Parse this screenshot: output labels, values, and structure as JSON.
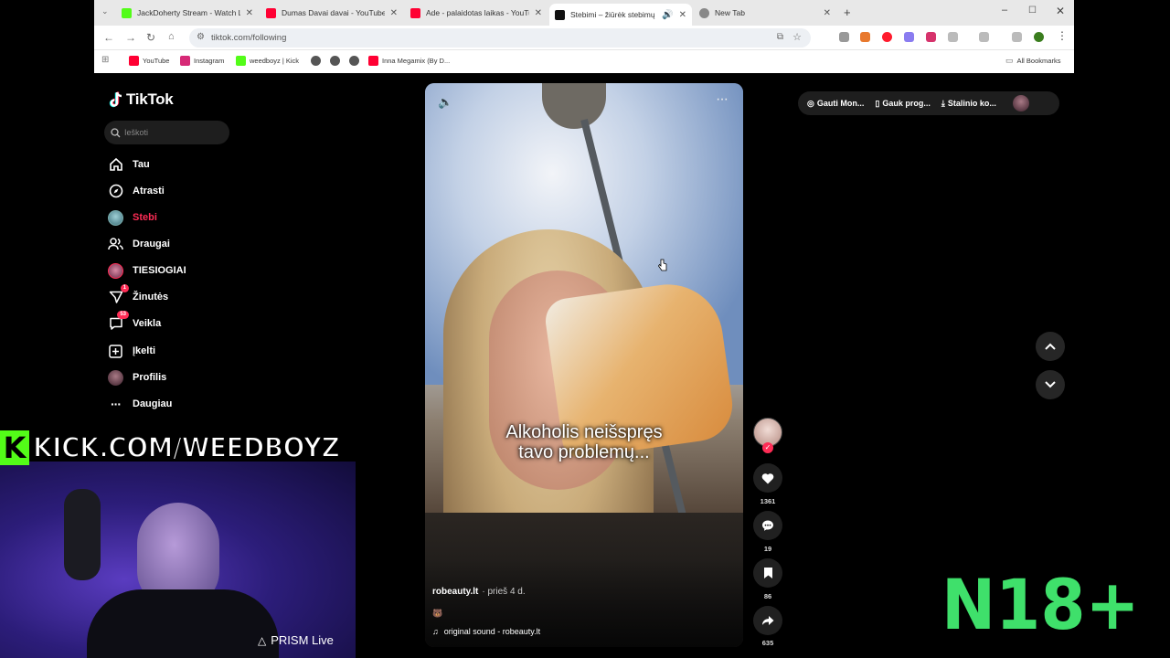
{
  "browser": {
    "tabs": [
      {
        "title": "JackDoherty Stream - Watch Liv",
        "fav_color": "#53fc18"
      },
      {
        "title": "Dumas Davai davai - YouTube",
        "fav_color": "#ff0033"
      },
      {
        "title": "Ade - palaidotas laikas - YouTu",
        "fav_color": "#ff0033"
      },
      {
        "title": "Stebimi – žiūrėk stebimų kū",
        "fav_color": "#111111"
      },
      {
        "title": "New Tab",
        "fav_color": "#888888"
      }
    ],
    "url": "tiktok.com/following",
    "bookmarks": [
      {
        "label": "YouTube",
        "fav_color": "#ff0033"
      },
      {
        "label": "Instagram",
        "fav_color": "#d62976"
      },
      {
        "label": "weedboyz | Kick",
        "fav_color": "#53fc18"
      },
      {
        "label": "",
        "fav_color": "#555555"
      },
      {
        "label": "",
        "fav_color": "#555555"
      },
      {
        "label": "",
        "fav_color": "#555555"
      },
      {
        "label": "Inna Megamix (By D...",
        "fav_color": "#ff0033"
      }
    ],
    "all_bookmarks": "All Bookmarks"
  },
  "tiktok": {
    "logo": "TikTok",
    "search_placeholder": "Ieškoti",
    "nav": [
      {
        "label": "Tau",
        "icon": "home-icon",
        "active": false
      },
      {
        "label": "Atrasti",
        "icon": "compass-icon",
        "active": false
      },
      {
        "label": "Stebi",
        "icon": "following-avatar-icon",
        "active": true
      },
      {
        "label": "Draugai",
        "icon": "friends-icon",
        "active": false
      },
      {
        "label": "TIESIOGIAI",
        "icon": "live-icon",
        "active": false
      },
      {
        "label": "Žinutės",
        "icon": "messages-icon",
        "active": false,
        "badge": "1"
      },
      {
        "label": "Veikla",
        "icon": "activity-icon",
        "active": false,
        "badge": "53"
      },
      {
        "label": "Įkelti",
        "icon": "upload-icon",
        "active": false
      },
      {
        "label": "Profilis",
        "icon": "profile-avatar-icon",
        "active": false
      },
      {
        "label": "Daugiau",
        "icon": "more-icon",
        "active": false
      }
    ],
    "top_actions": [
      "Gauti Mon...",
      "Gauk prog...",
      "Stalinio ko..."
    ],
    "video": {
      "caption_line1": "Alkoholis neišspręs",
      "caption_line2": "tavo problemų...",
      "author": "robeauty.lt",
      "time": "· prieš 4 d.",
      "emoji": "🐻",
      "sound": "original sound - robeauty.lt"
    },
    "actions": {
      "likes": "1361",
      "comments": "19",
      "saves": "86",
      "shares": "635"
    }
  },
  "overlay": {
    "kick_banner": "KICK.COM/WEEDBOYZ",
    "kick_logo": "K",
    "prism": "PRISM Live",
    "rating": "N18+"
  },
  "colors": {
    "accent": "#fe2c55",
    "kick_green": "#53fc18",
    "rating_green": "#3fe06b"
  }
}
